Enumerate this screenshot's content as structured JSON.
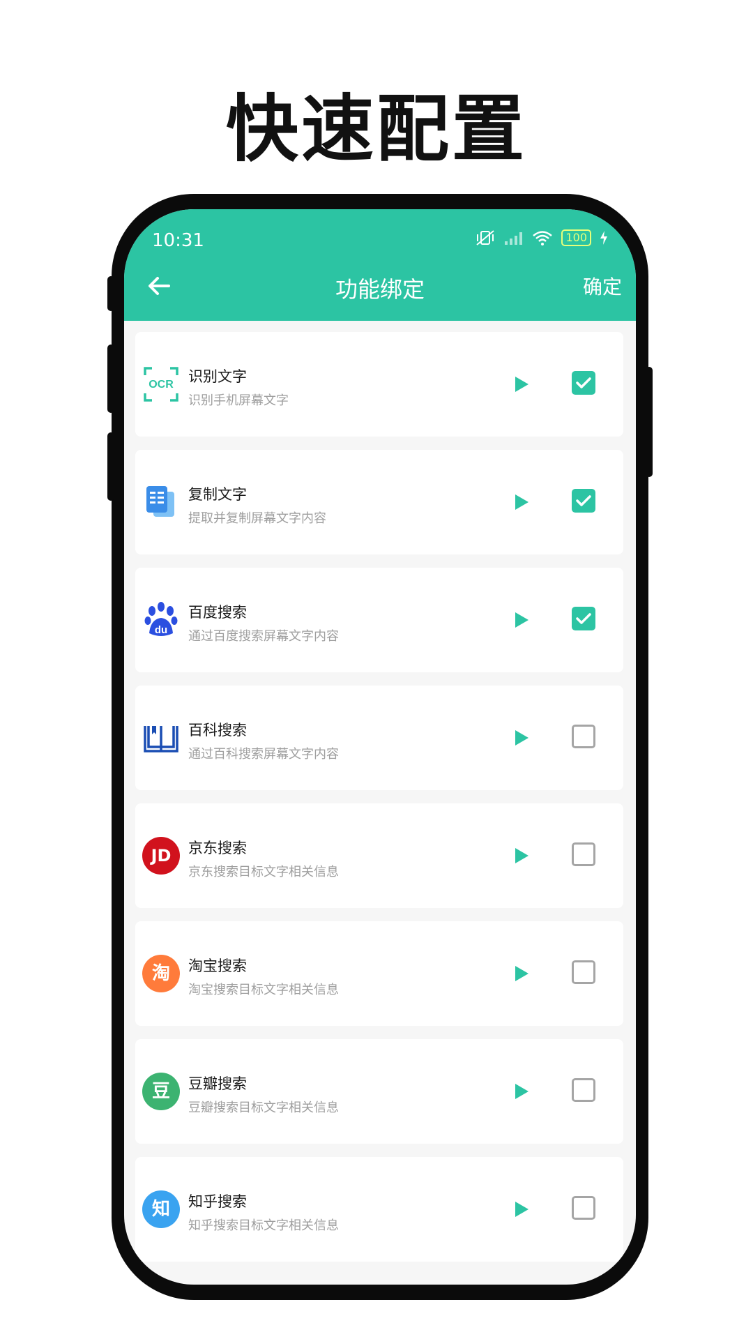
{
  "hero_title": "快速配置",
  "status": {
    "time": "10:31",
    "battery": "100"
  },
  "header": {
    "title": "功能绑定",
    "confirm_label": "确定"
  },
  "colors": {
    "accent": "#2cc4a3",
    "ocr": "#2cc4a3",
    "copy": "#3a8de8",
    "baidu": "#2b4fe0",
    "baike": "#1a4db3",
    "jd": "#d1121d",
    "taobao": "#ff7b3b",
    "douban": "#3cb371",
    "zhihu": "#3aa3f0"
  },
  "items": [
    {
      "title": "识别文字",
      "subtitle": "识别手机屏幕文字",
      "icon": "ocr-icon",
      "icon_text": "OCR",
      "checked": true
    },
    {
      "title": "复制文字",
      "subtitle": "提取并复制屏幕文字内容",
      "icon": "copy-doc-icon",
      "checked": true
    },
    {
      "title": "百度搜索",
      "subtitle": "通过百度搜索屏幕文字内容",
      "icon": "baidu-paw-icon",
      "icon_text": "du",
      "checked": true
    },
    {
      "title": "百科搜索",
      "subtitle": "通过百科搜索屏幕文字内容",
      "icon": "book-icon",
      "checked": false
    },
    {
      "title": "京东搜索",
      "subtitle": "京东搜索目标文字相关信息",
      "icon": "jd-icon",
      "icon_text": "JD",
      "checked": false
    },
    {
      "title": "淘宝搜索",
      "subtitle": "淘宝搜索目标文字相关信息",
      "icon": "taobao-icon",
      "icon_text": "淘",
      "checked": false
    },
    {
      "title": "豆瓣搜索",
      "subtitle": "豆瓣搜索目标文字相关信息",
      "icon": "douban-icon",
      "icon_text": "豆",
      "checked": false
    },
    {
      "title": "知乎搜索",
      "subtitle": "知乎搜索目标文字相关信息",
      "icon": "zhihu-icon",
      "icon_text": "知",
      "checked": false
    }
  ]
}
